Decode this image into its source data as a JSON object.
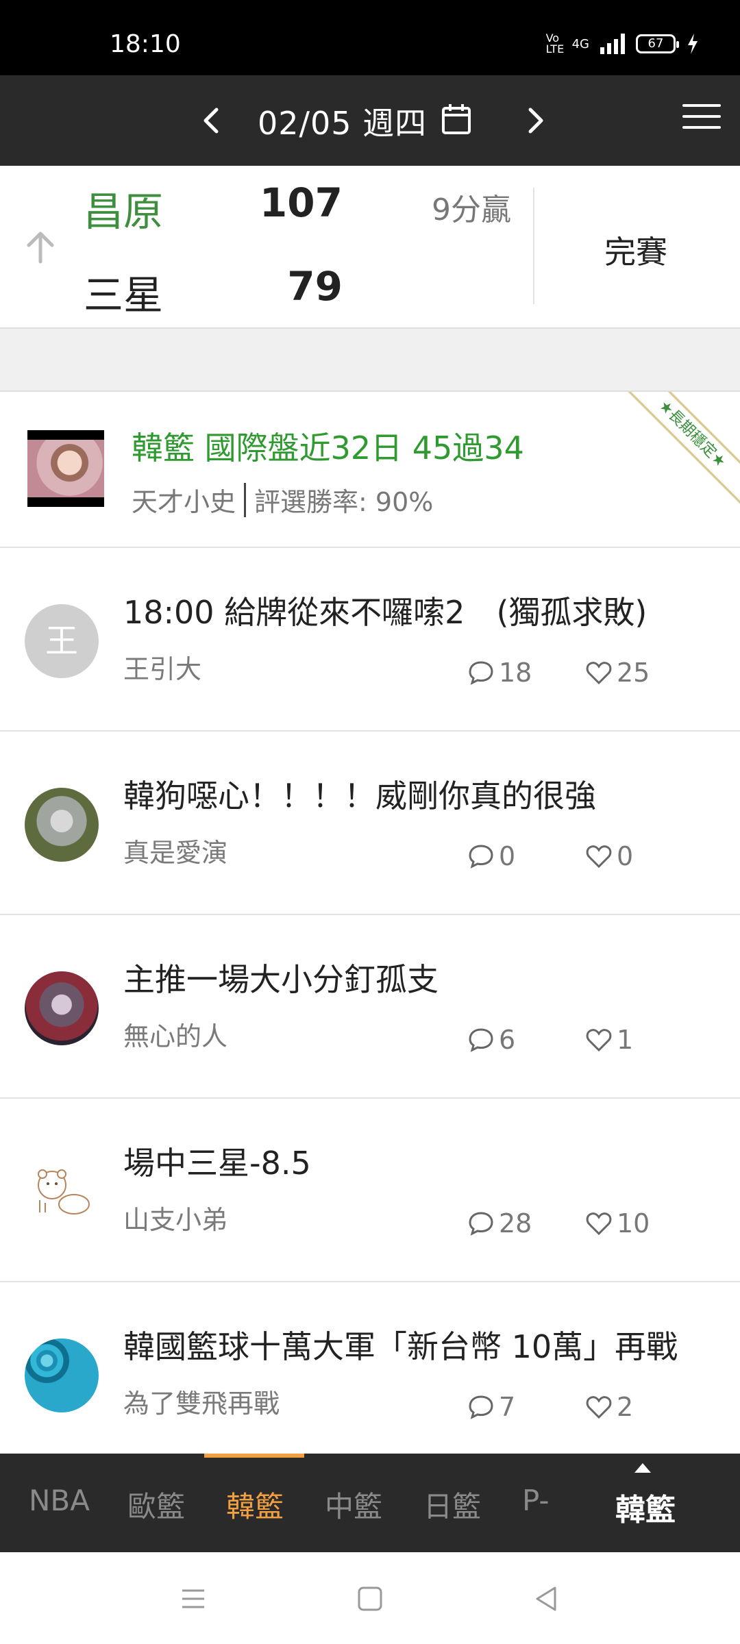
{
  "status_bar": {
    "time": "18:10",
    "network": "4G",
    "volte": "Vo LTE",
    "battery": "67"
  },
  "header": {
    "date": "02/05 週四"
  },
  "game": {
    "home_team": "昌原",
    "home_score": "107",
    "away_team": "三星",
    "away_score": "79",
    "result_note": "9分贏",
    "status": "完賽"
  },
  "featured": {
    "title": "韓籃 國際盤近32日 45過34",
    "author": "天才小史",
    "win_rate": "評選勝率: 90%",
    "ribbon": "長期穩定"
  },
  "posts": [
    {
      "title": "18:00 給牌從來不囉嗦2　(獨孤求敗)",
      "author": "王引大",
      "comments": "18",
      "likes": "25",
      "avatar_text": "王"
    },
    {
      "title": "韓狗噁心！！！！威剛你真的很強",
      "author": "真是愛演",
      "comments": "0",
      "likes": "0"
    },
    {
      "title": "主推一場大小分釘孤支",
      "author": "無心的人",
      "comments": "6",
      "likes": "1"
    },
    {
      "title": "場中三星-8.5",
      "author": "山支小弟",
      "comments": "28",
      "likes": "10"
    },
    {
      "title": "韓國籃球十萬大軍「新台幣 10萬」再戰",
      "author": "為了雙飛再戰",
      "comments": "7",
      "likes": "2"
    }
  ],
  "tabs": [
    "NBA",
    "歐籃",
    "韓籃",
    "中籃",
    "日籃",
    "P-"
  ],
  "current_league": "韓籃",
  "colors": {
    "accent": "#f0a040",
    "win_green": "#3d8f3d",
    "header_bg": "#2a2a2a"
  }
}
